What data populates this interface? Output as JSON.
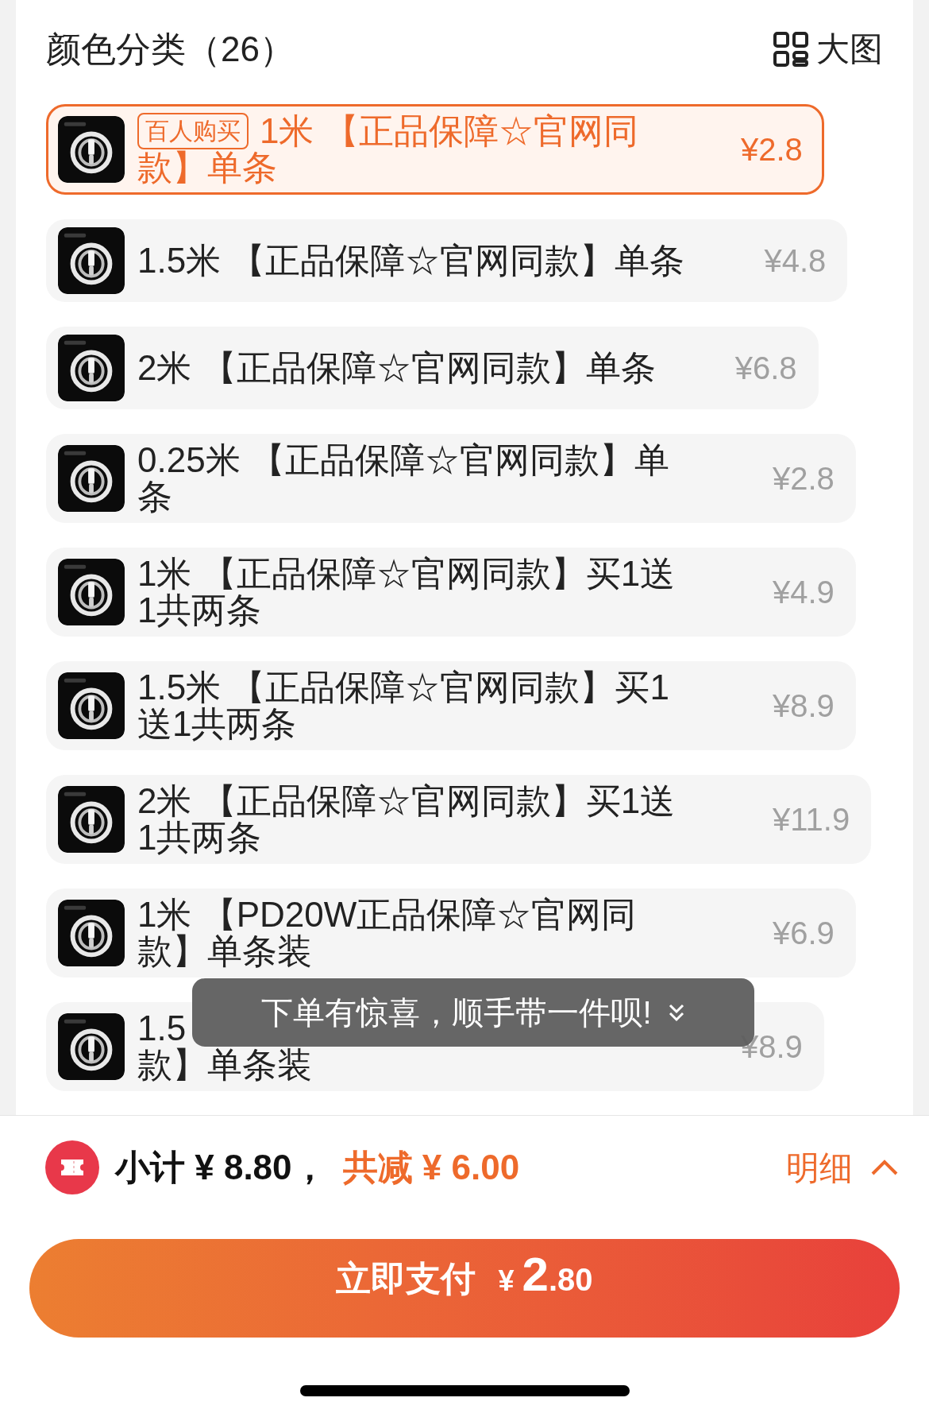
{
  "header": {
    "title": "颜色分类（26）",
    "view_toggle": "大图"
  },
  "variants": [
    {
      "badge": "百人购买",
      "name_lines": [
        "1米 【正品保障☆官网同",
        "款】单条"
      ],
      "price": "¥2.8",
      "selected": true
    },
    {
      "name": "1.5米 【正品保障☆官网同款】单条",
      "price": "¥4.8",
      "selected": false
    },
    {
      "name": "2米 【正品保障☆官网同款】单条",
      "price": "¥6.8",
      "selected": false
    },
    {
      "name": "0.25米 【正品保障☆官网同款】单条",
      "price": "¥2.8",
      "selected": false
    },
    {
      "name": "1米 【正品保障☆官网同款】买1送1共两条",
      "price": "¥4.9",
      "selected": false
    },
    {
      "name": "1.5米 【正品保障☆官网同款】买1送1共两条",
      "price": "¥8.9",
      "selected": false
    },
    {
      "name": "2米 【正品保障☆官网同款】买1送1共两条",
      "price": "¥11.9",
      "selected": false
    },
    {
      "name": "1米 【PD20W正品保障☆官网同款】单条装",
      "price": "¥6.9",
      "selected": false
    },
    {
      "name_lines": [
        "1.5",
        "款】单条装"
      ],
      "price": "¥8.9",
      "selected": false
    }
  ],
  "toast": {
    "text": "下单有惊喜，顺手带一件呗!"
  },
  "summary": {
    "subtotal": "小计 ¥ 8.80，",
    "discount": "共减 ¥ 6.00",
    "details": "明细"
  },
  "pay_button": {
    "label": "立即支付",
    "currency": "¥",
    "amount_integer": "2",
    "amount_decimal": ".80"
  }
}
